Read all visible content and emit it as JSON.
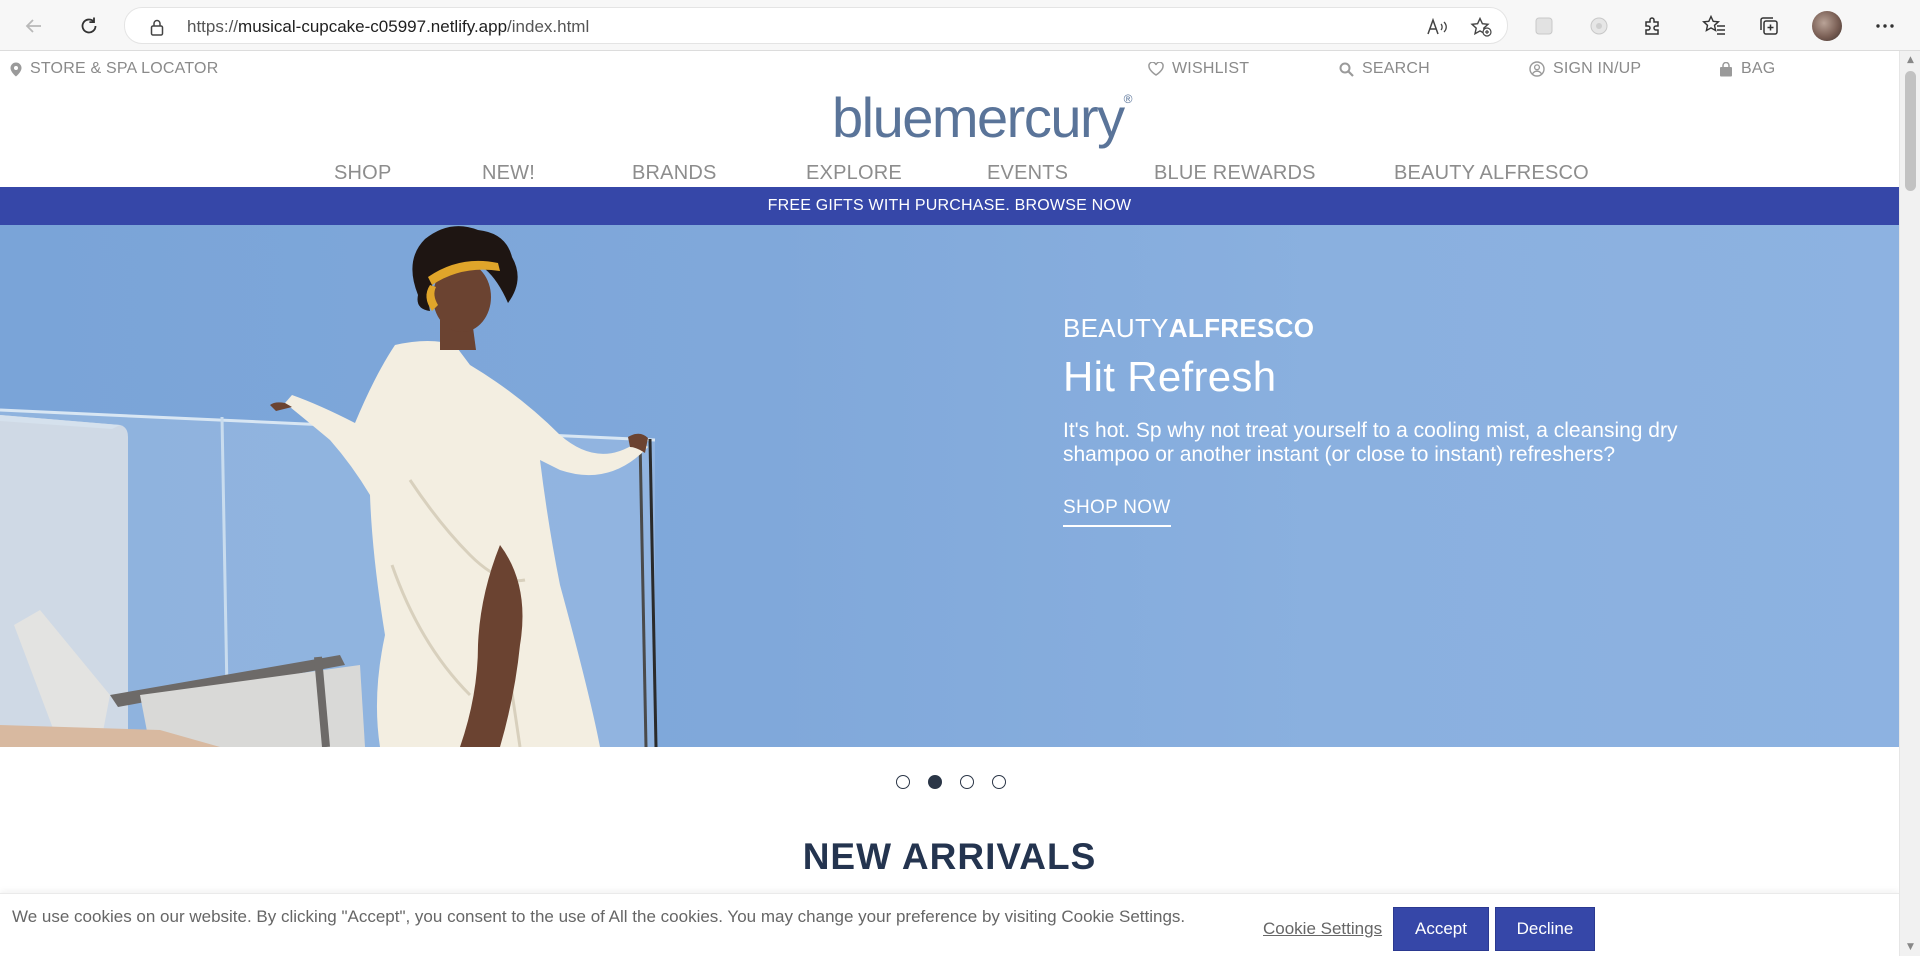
{
  "browser": {
    "url_prefix": "https://",
    "url_host": "musical-cupcake-c05997.netlify.app",
    "url_path": "/index.html"
  },
  "utility_nav": {
    "store_locator": "STORE & SPA LOCATOR",
    "wishlist": "WISHLIST",
    "search": "SEARCH",
    "sign_in": "SIGN IN/UP",
    "bag": "BAG"
  },
  "logo": {
    "text": "bluemercury",
    "mark": "®"
  },
  "main_nav": {
    "items": [
      "SHOP",
      "NEW!",
      "BRANDS",
      "EXPLORE",
      "EVENTS",
      "BLUE REWARDS",
      "BEAUTY ALFRESCO"
    ]
  },
  "promo": {
    "text": "FREE GIFTS WITH PURCHASE. BROWSE NOW"
  },
  "hero": {
    "eyebrow_light": "BEAUTY",
    "eyebrow_bold": "ALFRESCO",
    "title": "Hit Refresh",
    "description": "It's hot. Sp why not treat yourself to a cooling mist, a cleansing dry shampoo or another instant (or close to instant) refreshers?",
    "cta": "SHOP NOW"
  },
  "carousel": {
    "slide_count": 4,
    "active_slide": 2
  },
  "section": {
    "title": "NEW ARRIVALS"
  },
  "cookie_banner": {
    "text": "We use cookies on our website. By clicking \"Accept\", you consent to the use of All the cookies. You may change your preference by visiting Cookie Settings.",
    "settings_link": "Cookie Settings",
    "accept": "Accept",
    "decline": "Decline"
  },
  "colors": {
    "brand_blue": "#3647a8",
    "logo_blue": "#5a7499",
    "hero_sky": "#80a8da",
    "heading_navy": "#24344f"
  }
}
